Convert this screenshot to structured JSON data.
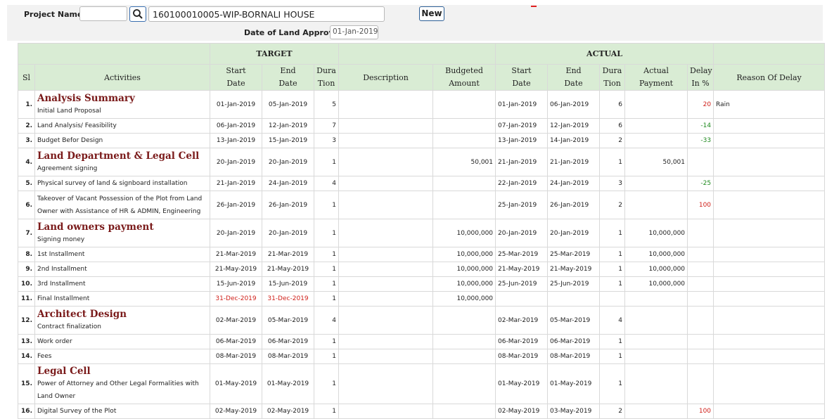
{
  "header": {
    "project_label": "Project Name:",
    "project_code": "",
    "project_name": "160100010005-WIP-BORNALI HOUSE",
    "new_button": "New",
    "approval_label": "Date of Land Approval",
    "approval_date": "01-Jan-2019"
  },
  "table": {
    "group_target": "TARGET",
    "group_actual": "ACTUAL",
    "columns": {
      "sl": "Sl",
      "activities": "Activities",
      "start_l1": "Start",
      "start_l2": "Date",
      "end_l1": "End",
      "end_l2": "Date",
      "dur_l1": "Dura",
      "dur_l2": "Tion",
      "description": "Description",
      "budget_l1": "Budgeted",
      "budget_l2": "Amount",
      "astart_l1": "Start",
      "astart_l2": "Date",
      "aend_l1": "End",
      "aend_l2": "Date",
      "adur_l1": "Dura",
      "adur_l2": "Tion",
      "apay_l1": "Actual",
      "apay_l2": "Payment",
      "delay_l1": "Delay",
      "delay_l2": "In %",
      "reason": "Reason Of Delay"
    },
    "rows": [
      {
        "sl": "1.",
        "section": "Analysis Summary",
        "activity": "Initial Land Proposal",
        "t_start": "01-Jan-2019",
        "t_end": "05-Jan-2019",
        "t_dur": "5",
        "desc": "",
        "budget": "",
        "a_start": "01-Jan-2019",
        "a_end": "06-Jan-2019",
        "a_dur": "6",
        "a_pay": "",
        "delay": "20",
        "delay_color": "red",
        "reason": "Rain"
      },
      {
        "sl": "2.",
        "section": "",
        "activity": "Land Analysis/ Feasibility",
        "t_start": "06-Jan-2019",
        "t_end": "12-Jan-2019",
        "t_dur": "7",
        "desc": "",
        "budget": "",
        "a_start": "07-Jan-2019",
        "a_end": "12-Jan-2019",
        "a_dur": "6",
        "a_pay": "",
        "delay": "-14",
        "delay_color": "green",
        "reason": ""
      },
      {
        "sl": "3.",
        "section": "",
        "activity": "Budget Befor Design",
        "t_start": "13-Jan-2019",
        "t_end": "15-Jan-2019",
        "t_dur": "3",
        "desc": "",
        "budget": "",
        "a_start": "13-Jan-2019",
        "a_end": "14-Jan-2019",
        "a_dur": "2",
        "a_pay": "",
        "delay": "-33",
        "delay_color": "green",
        "reason": ""
      },
      {
        "sl": "4.",
        "section": "Land Department & Legal Cell",
        "activity": "Agreement signing",
        "t_start": "20-Jan-2019",
        "t_end": "20-Jan-2019",
        "t_dur": "1",
        "desc": "",
        "budget": "50,001",
        "a_start": "21-Jan-2019",
        "a_end": "21-Jan-2019",
        "a_dur": "1",
        "a_pay": "50,001",
        "delay": "",
        "delay_color": "",
        "reason": ""
      },
      {
        "sl": "5.",
        "section": "",
        "activity": "Physical survey of land & signboard installation",
        "t_start": "21-Jan-2019",
        "t_end": "24-Jan-2019",
        "t_dur": "4",
        "desc": "",
        "budget": "",
        "a_start": "22-Jan-2019",
        "a_end": "24-Jan-2019",
        "a_dur": "3",
        "a_pay": "",
        "delay": "-25",
        "delay_color": "green",
        "reason": ""
      },
      {
        "sl": "6.",
        "section": "",
        "activity": "Takeover of Vacant Possession of the Plot from Land",
        "activity2": "Owner with Assistance of HR & ADMIN, Engineering",
        "t_start": "26-Jan-2019",
        "t_end": "26-Jan-2019",
        "t_dur": "1",
        "desc": "",
        "budget": "",
        "a_start": "25-Jan-2019",
        "a_end": "26-Jan-2019",
        "a_dur": "2",
        "a_pay": "",
        "delay": "100",
        "delay_color": "red",
        "reason": ""
      },
      {
        "sl": "7.",
        "section": "Land owners payment",
        "activity": "Signing money",
        "t_start": "20-Jan-2019",
        "t_end": "20-Jan-2019",
        "t_dur": "1",
        "desc": "",
        "budget": "10,000,000",
        "a_start": "20-Jan-2019",
        "a_end": "20-Jan-2019",
        "a_dur": "1",
        "a_pay": "10,000,000",
        "delay": "",
        "delay_color": "",
        "reason": ""
      },
      {
        "sl": "8.",
        "section": "",
        "activity": "1st Installment",
        "t_start": "21-Mar-2019",
        "t_end": "21-Mar-2019",
        "t_dur": "1",
        "desc": "",
        "budget": "10,000,000",
        "a_start": "25-Mar-2019",
        "a_end": "25-Mar-2019",
        "a_dur": "1",
        "a_pay": "10,000,000",
        "delay": "",
        "delay_color": "",
        "reason": ""
      },
      {
        "sl": "9.",
        "section": "",
        "activity": "2nd Installment",
        "t_start": "21-May-2019",
        "t_end": "21-May-2019",
        "t_dur": "1",
        "desc": "",
        "budget": "10,000,000",
        "a_start": "21-May-2019",
        "a_end": "21-May-2019",
        "a_dur": "1",
        "a_pay": "10,000,000",
        "delay": "",
        "delay_color": "",
        "reason": ""
      },
      {
        "sl": "10.",
        "section": "",
        "activity": "3rd Installment",
        "t_start": "15-Jun-2019",
        "t_end": "15-Jun-2019",
        "t_dur": "1",
        "desc": "",
        "budget": "10,000,000",
        "a_start": "25-Jun-2019",
        "a_end": "25-Jun-2019",
        "a_dur": "1",
        "a_pay": "10,000,000",
        "delay": "",
        "delay_color": "",
        "reason": ""
      },
      {
        "sl": "11.",
        "section": "",
        "activity": "Final Installment",
        "t_start": "31-Dec-2019",
        "t_end": "31-Dec-2019",
        "t_dur": "1",
        "desc": "",
        "budget": "10,000,000",
        "a_start": "",
        "a_end": "",
        "a_dur": "",
        "a_pay": "",
        "delay": "",
        "delay_color": "",
        "reason": "",
        "target_late": true
      },
      {
        "sl": "12.",
        "section": "Architect Design",
        "activity": "Contract finalization",
        "t_start": "02-Mar-2019",
        "t_end": "05-Mar-2019",
        "t_dur": "4",
        "desc": "",
        "budget": "",
        "a_start": "02-Mar-2019",
        "a_end": "05-Mar-2019",
        "a_dur": "4",
        "a_pay": "",
        "delay": "",
        "delay_color": "",
        "reason": ""
      },
      {
        "sl": "13.",
        "section": "",
        "activity": "Work order",
        "t_start": "06-Mar-2019",
        "t_end": "06-Mar-2019",
        "t_dur": "1",
        "desc": "",
        "budget": "",
        "a_start": "06-Mar-2019",
        "a_end": "06-Mar-2019",
        "a_dur": "1",
        "a_pay": "",
        "delay": "",
        "delay_color": "",
        "reason": ""
      },
      {
        "sl": "14.",
        "section": "",
        "activity": "Fees",
        "t_start": "08-Mar-2019",
        "t_end": "08-Mar-2019",
        "t_dur": "1",
        "desc": "",
        "budget": "",
        "a_start": "08-Mar-2019",
        "a_end": "08-Mar-2019",
        "a_dur": "1",
        "a_pay": "",
        "delay": "",
        "delay_color": "",
        "reason": ""
      },
      {
        "sl": "15.",
        "section": "Legal Cell",
        "activity": "Power of Attorney and Other Legal Formalities with",
        "activity2": "Land Owner",
        "t_start": "01-May-2019",
        "t_end": "01-May-2019",
        "t_dur": "1",
        "desc": "",
        "budget": "",
        "a_start": "01-May-2019",
        "a_end": "01-May-2019",
        "a_dur": "1",
        "a_pay": "",
        "delay": "",
        "delay_color": "",
        "reason": ""
      },
      {
        "sl": "16.",
        "section": "",
        "activity": "Digital Survey of the Plot",
        "t_start": "02-May-2019",
        "t_end": "02-May-2019",
        "t_dur": "1",
        "desc": "",
        "budget": "",
        "a_start": "02-May-2019",
        "a_end": "03-May-2019",
        "a_dur": "2",
        "a_pay": "",
        "delay": "100",
        "delay_color": "red",
        "reason": ""
      }
    ]
  }
}
